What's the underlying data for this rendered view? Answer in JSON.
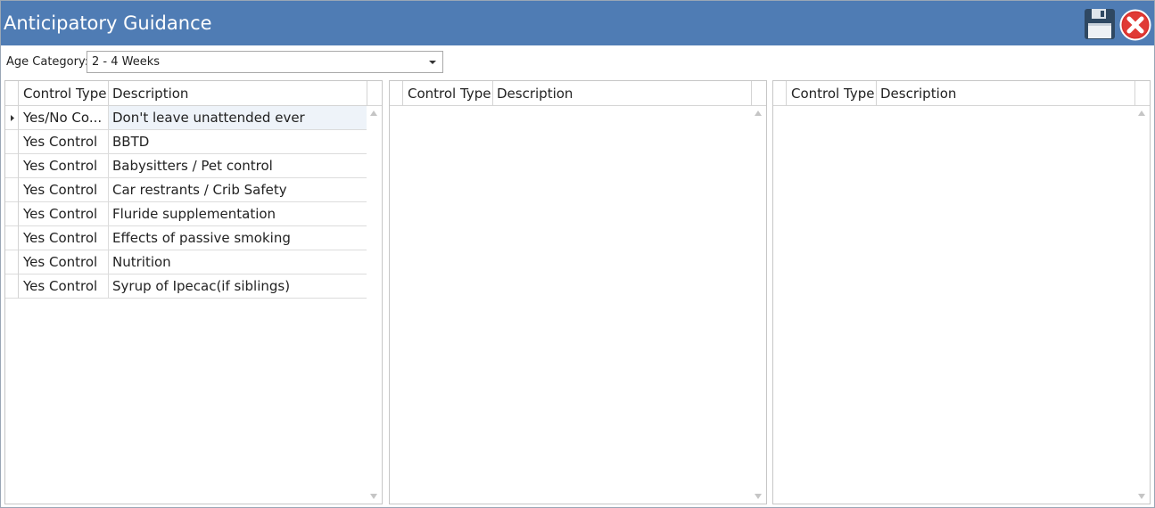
{
  "window": {
    "title": "Anticipatory Guidance"
  },
  "toolbar": {
    "save_icon": "floppy-disk-icon",
    "close_icon": "red-x-close-icon"
  },
  "age_category": {
    "label": "Age Category:",
    "selected": "2 - 4 Weeks"
  },
  "grids": [
    {
      "columns": [
        "Control Type",
        "Description"
      ],
      "rows": [
        {
          "type": "Yes/No Co...",
          "description": "Don't leave unattended ever",
          "selected": true
        },
        {
          "type": "Yes Control",
          "description": "BBTD"
        },
        {
          "type": "Yes Control",
          "description": "Babysitters / Pet control"
        },
        {
          "type": "Yes Control",
          "description": "Car restrants / Crib Safety"
        },
        {
          "type": "Yes Control",
          "description": "Fluride supplementation"
        },
        {
          "type": "Yes Control",
          "description": "Effects of passive smoking"
        },
        {
          "type": "Yes Control",
          "description": "Nutrition"
        },
        {
          "type": "Yes Control",
          "description": "Syrup of Ipecac(if siblings)"
        }
      ]
    },
    {
      "columns": [
        "Control Type",
        "Description"
      ],
      "rows": []
    },
    {
      "columns": [
        "Control Type",
        "Description"
      ],
      "rows": []
    }
  ],
  "colors": {
    "titlebar": "#4f7cb4",
    "selected_row": "#eef3f9"
  }
}
